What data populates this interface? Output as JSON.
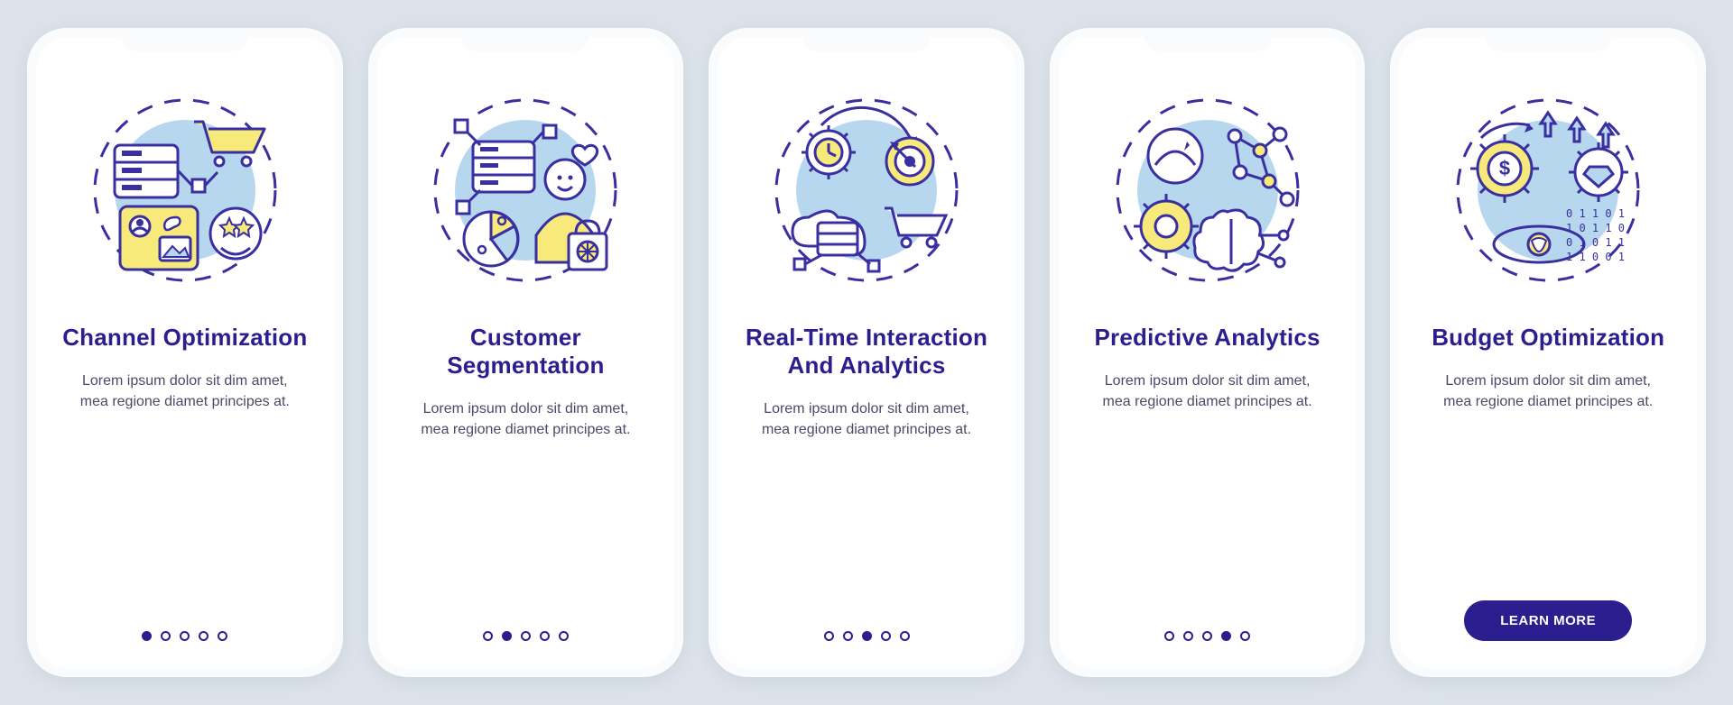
{
  "colors": {
    "accent": "#2d1e8f",
    "bg": "#dbe2ea",
    "card": "#ffffff",
    "text": "#4a4a68",
    "illus_fill_blue": "#b7d7ef",
    "illus_fill_yellow": "#f7e97a",
    "illus_stroke": "#3a2fa0"
  },
  "cards": [
    {
      "icon": "channel-optimization-icon",
      "title": "Channel Optimization",
      "body": "Lorem ipsum dolor sit dim amet, mea regione diamet principes at.",
      "active_dot": 0
    },
    {
      "icon": "customer-segmentation-icon",
      "title": "Customer Segmentation",
      "body": "Lorem ipsum dolor sit dim amet, mea regione diamet principes at.",
      "active_dot": 1
    },
    {
      "icon": "real-time-interaction-icon",
      "title": "Real-Time Interaction And Analytics",
      "body": "Lorem ipsum dolor sit dim amet, mea regione diamet principes at.",
      "active_dot": 2
    },
    {
      "icon": "predictive-analytics-icon",
      "title": "Predictive Analytics",
      "body": "Lorem ipsum dolor sit dim amet, mea regione diamet principes at.",
      "active_dot": 3
    },
    {
      "icon": "budget-optimization-icon",
      "title": "Budget Optimization",
      "body": "Lorem ipsum dolor sit dim amet, mea regione diamet principes at.",
      "active_dot": 4,
      "cta_label": "LEARN MORE"
    }
  ],
  "dots_count": 5
}
